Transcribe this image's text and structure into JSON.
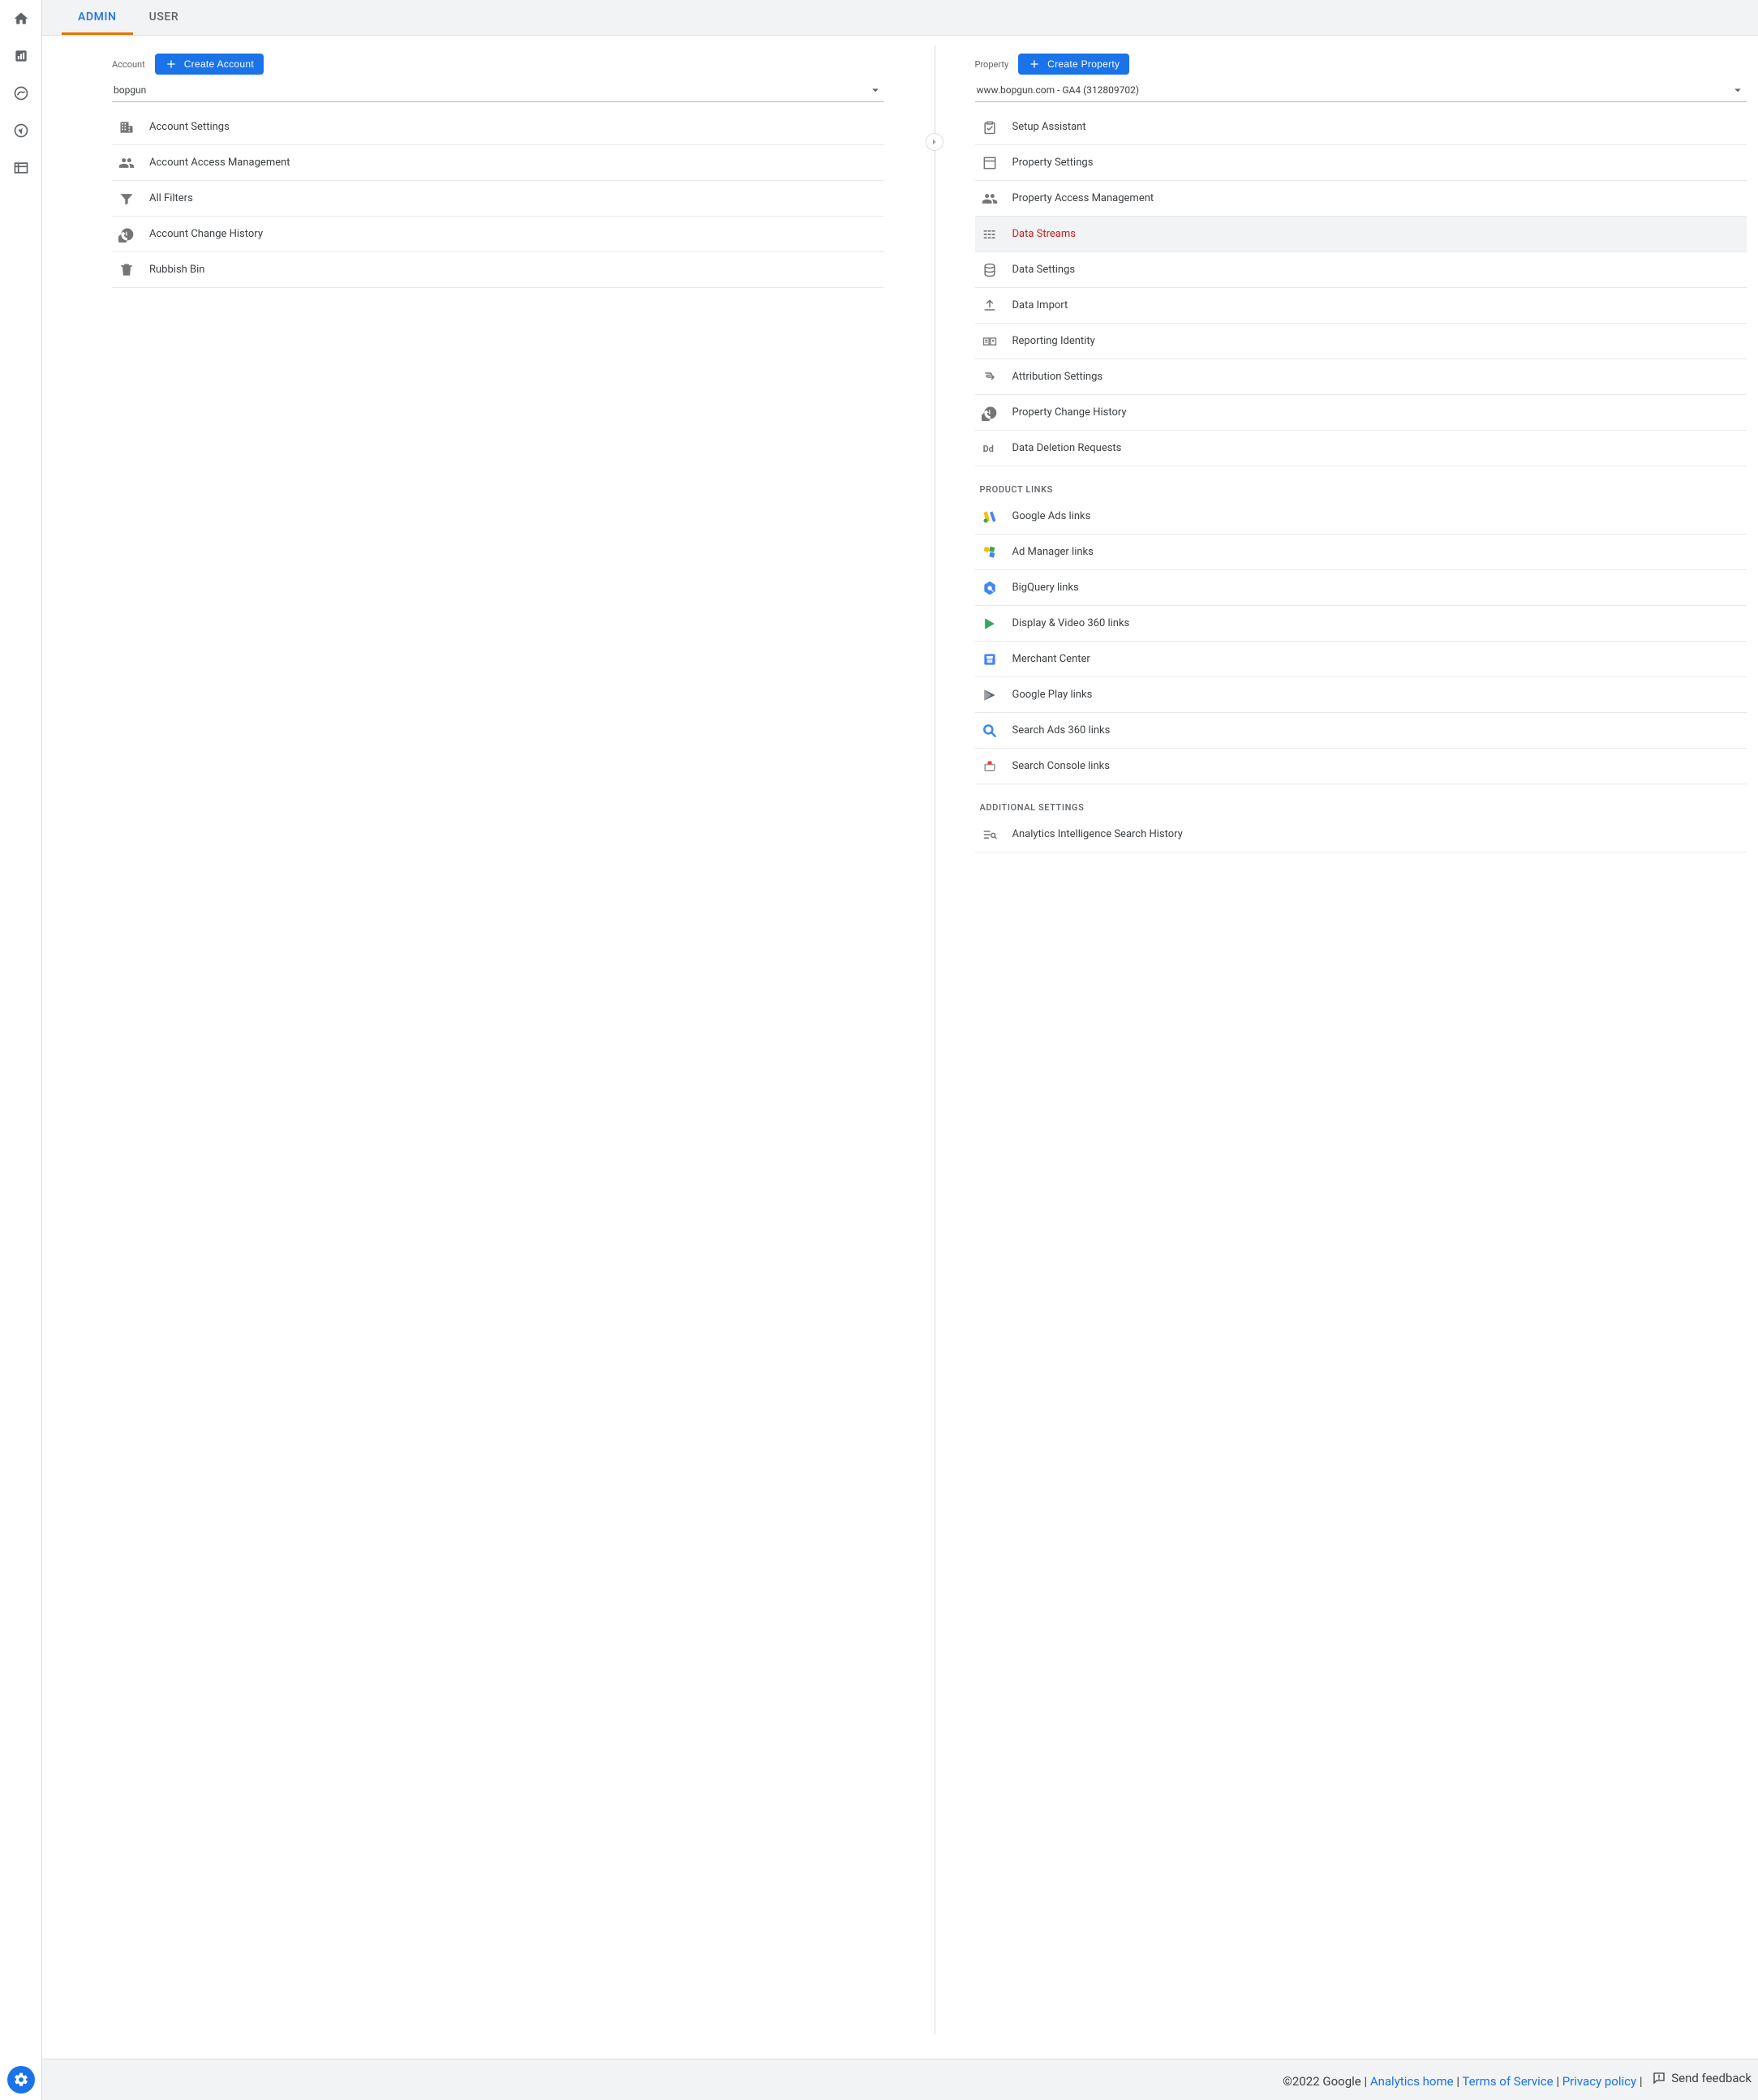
{
  "tabs": {
    "admin": "ADMIN",
    "user": "USER"
  },
  "account": {
    "label": "Account",
    "create": "Create Account",
    "selected": "bopgun",
    "items": [
      {
        "id": "account-settings",
        "label": "Account Settings",
        "icon": "building"
      },
      {
        "id": "account-access",
        "label": "Account Access Management",
        "icon": "people"
      },
      {
        "id": "all-filters",
        "label": "All Filters",
        "icon": "filter"
      },
      {
        "id": "account-history",
        "label": "Account Change History",
        "icon": "history"
      },
      {
        "id": "rubbish-bin",
        "label": "Rubbish Bin",
        "icon": "trash"
      }
    ]
  },
  "property": {
    "label": "Property",
    "create": "Create Property",
    "selected": "www.bopgun.com - GA4 (312809702)",
    "items": [
      {
        "id": "setup-assistant",
        "label": "Setup Assistant",
        "icon": "clipboard-check"
      },
      {
        "id": "property-settings",
        "label": "Property Settings",
        "icon": "layout"
      },
      {
        "id": "property-access",
        "label": "Property Access Management",
        "icon": "people"
      },
      {
        "id": "data-streams",
        "label": "Data Streams",
        "icon": "streams",
        "selected": true
      },
      {
        "id": "data-settings",
        "label": "Data Settings",
        "icon": "database"
      },
      {
        "id": "data-import",
        "label": "Data Import",
        "icon": "upload"
      },
      {
        "id": "reporting-identity",
        "label": "Reporting Identity",
        "icon": "identity"
      },
      {
        "id": "attribution-settings",
        "label": "Attribution Settings",
        "icon": "attribution"
      },
      {
        "id": "property-history",
        "label": "Property Change History",
        "icon": "history"
      },
      {
        "id": "data-deletion",
        "label": "Data Deletion Requests",
        "icon": "dd"
      }
    ],
    "productLinksHeading": "PRODUCT LINKS",
    "productLinks": [
      {
        "id": "google-ads",
        "label": "Google Ads links",
        "icon": "google-ads"
      },
      {
        "id": "ad-manager",
        "label": "Ad Manager links",
        "icon": "ad-manager"
      },
      {
        "id": "bigquery",
        "label": "BigQuery links",
        "icon": "bigquery"
      },
      {
        "id": "dv360",
        "label": "Display & Video 360 links",
        "icon": "dv360"
      },
      {
        "id": "merchant-center",
        "label": "Merchant Center",
        "icon": "merchant"
      },
      {
        "id": "google-play",
        "label": "Google Play links",
        "icon": "play"
      },
      {
        "id": "search-ads",
        "label": "Search Ads 360 links",
        "icon": "search-ads"
      },
      {
        "id": "search-console",
        "label": "Search Console links",
        "icon": "search-console"
      }
    ],
    "additionalHeading": "ADDITIONAL SETTINGS",
    "additional": [
      {
        "id": "analytics-intel",
        "label": "Analytics Intelligence Search History",
        "icon": "intel"
      }
    ]
  },
  "footer": {
    "copyright": "©2022 Google",
    "analyticsHome": "Analytics home",
    "terms": "Terms of Service",
    "privacy": "Privacy policy",
    "feedback": "Send feedback"
  }
}
